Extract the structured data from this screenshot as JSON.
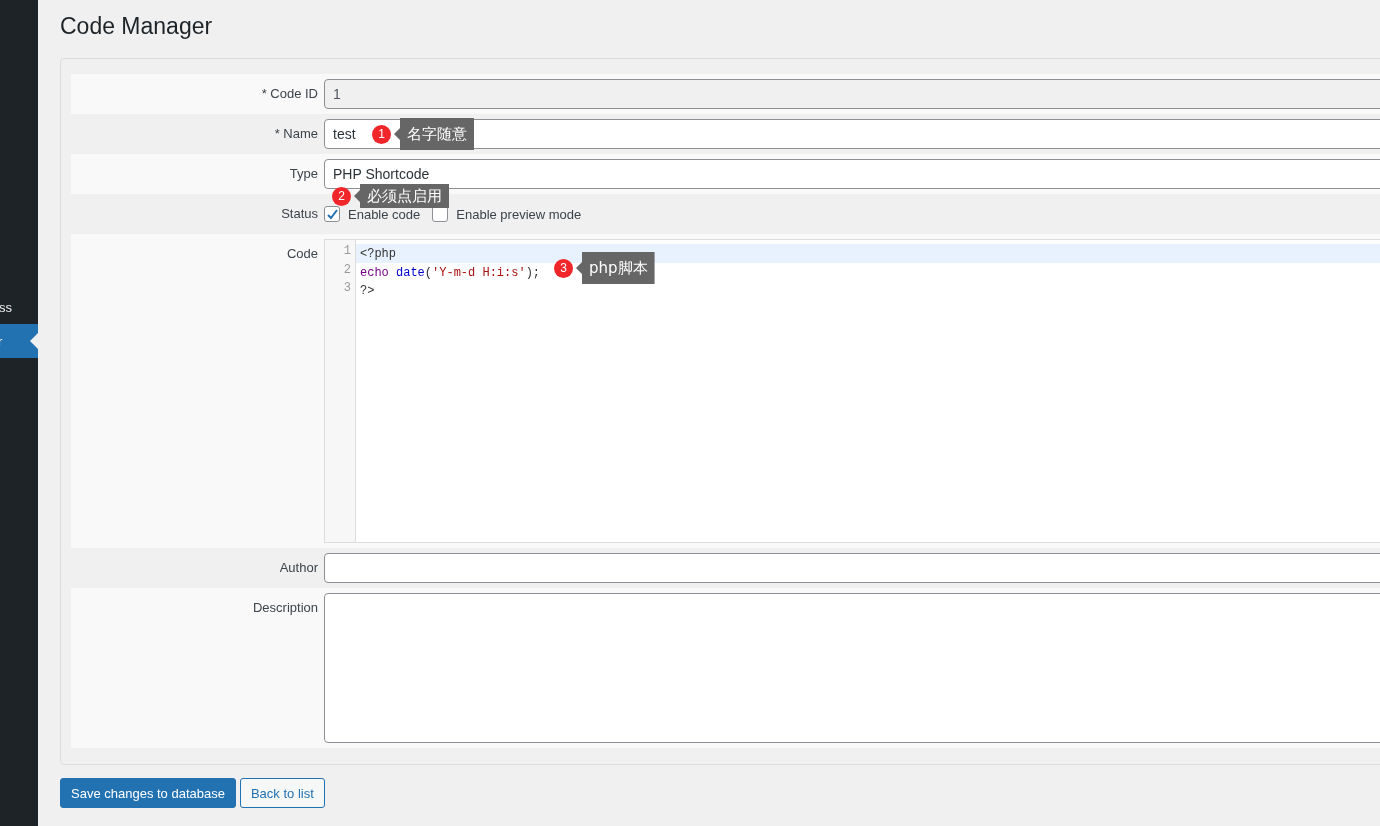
{
  "sidebar": {
    "items": [
      {
        "label": "ss",
        "selected": false
      },
      {
        "label": "r",
        "selected": true
      }
    ]
  },
  "page_title": "Code Manager",
  "form": {
    "fields": [
      {
        "kind": "text",
        "label": "* Code ID",
        "value": "1",
        "disabled": true
      },
      {
        "kind": "text",
        "label": "* Name",
        "value": "test",
        "disabled": false
      },
      {
        "kind": "text",
        "label": "Type",
        "value": "PHP Shortcode",
        "disabled": false
      },
      {
        "kind": "checkboxes",
        "label": "Status",
        "options": [
          {
            "label": "Enable code",
            "checked": true
          },
          {
            "label": "Enable preview mode",
            "checked": false
          }
        ]
      },
      {
        "kind": "code",
        "label": "Code",
        "lines": [
          {
            "number": "1",
            "highlighted": true,
            "tokens": [
              {
                "text": "<?php",
                "kind": "plain"
              }
            ]
          },
          {
            "number": "2",
            "highlighted": false,
            "tokens": [
              {
                "text": "echo",
                "kind": "keyword"
              },
              {
                "text": " date",
                "kind": "function"
              },
              {
                "text": "(",
                "kind": "plain"
              },
              {
                "text": "'Y-m-d H:i:s'",
                "kind": "string"
              },
              {
                "text": ");",
                "kind": "plain"
              }
            ]
          },
          {
            "number": "3",
            "highlighted": false,
            "tokens": [
              {
                "text": "?>",
                "kind": "plain"
              }
            ]
          }
        ]
      },
      {
        "kind": "text",
        "label": "Author",
        "disabled": false
      },
      {
        "kind": "textarea",
        "label": "Description"
      }
    ]
  },
  "buttons": [
    {
      "label": "Save changes to database",
      "kind": "primary"
    },
    {
      "label": "Back to list",
      "kind": "secondary"
    }
  ],
  "annotations": [
    {
      "number": "1",
      "text": "名字随意"
    },
    {
      "number": "2",
      "text": "必须点启用"
    },
    {
      "number": "3",
      "text": "php脚本"
    }
  ]
}
